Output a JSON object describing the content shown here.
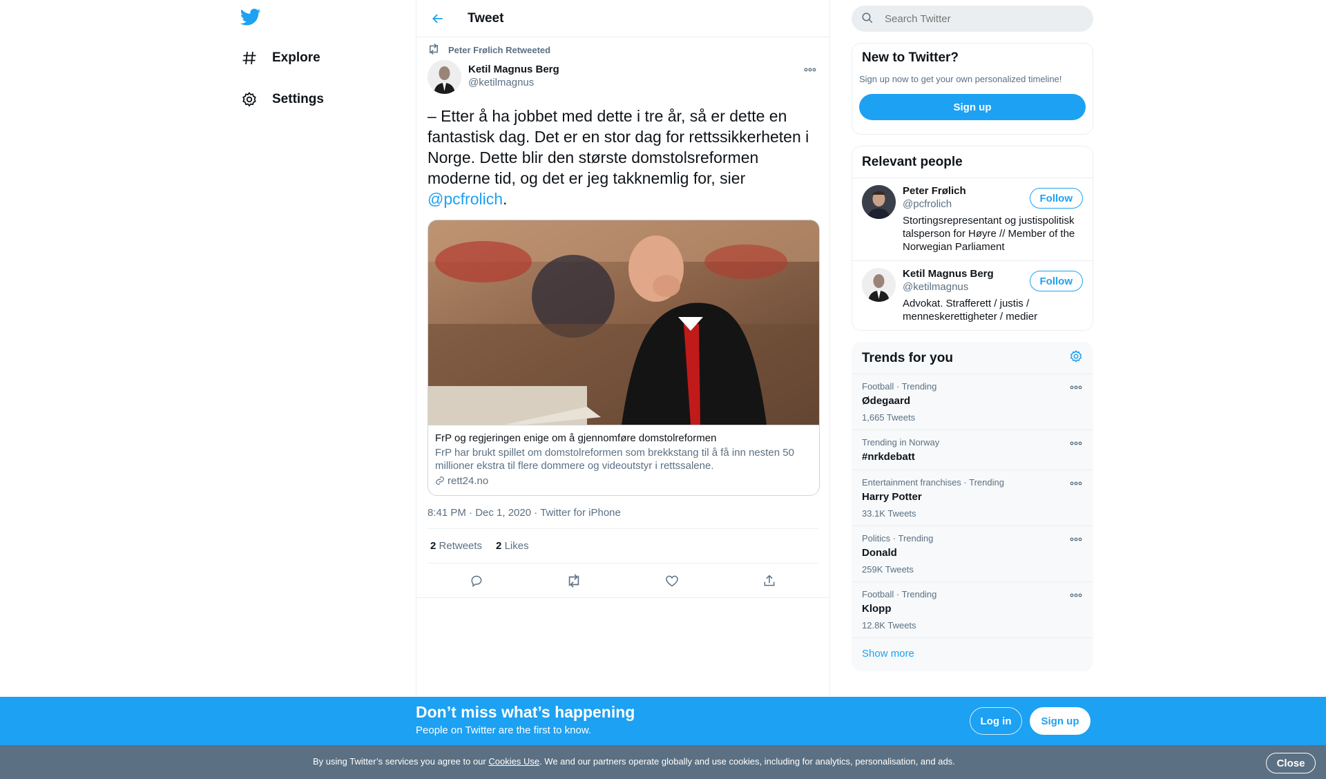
{
  "nav": {
    "items": [
      {
        "label": "Explore",
        "icon": "hashtag-icon"
      },
      {
        "label": "Settings",
        "icon": "gear-icon"
      }
    ]
  },
  "header": {
    "title": "Tweet"
  },
  "tweet": {
    "retweeted_by": "Peter Frølich Retweeted",
    "author_name": "Ketil Magnus Berg",
    "author_handle": "@ketilmagnus",
    "text_before": "– Etter å ha jobbet med dette i tre år, så er dette en fantastisk dag. Det er en stor dag for rettssikkerheten i Norge. Dette blir den største domstolsreformen moderne tid, og det er jeg takknemlig for, sier ",
    "mention": "@pcfrolich",
    "text_after": ".",
    "card": {
      "title": "FrP og regjeringen enige om å gjennomføre domstolreformen",
      "description": "FrP har brukt spillet om domstolreformen som brekkstang til å få inn nesten 50 millioner ekstra til flere dommere og videoutstyr i rettssalene.",
      "domain": "rett24.no"
    },
    "meta": "8:41 PM · Dec 1, 2020 · Twitter for iPhone",
    "retweets_count": "2",
    "retweets_label": "Retweets",
    "likes_count": "2",
    "likes_label": "Likes"
  },
  "search": {
    "placeholder": "Search Twitter"
  },
  "new_to_twitter": {
    "title": "New to Twitter?",
    "subtitle": "Sign up now to get your own personalized timeline!",
    "button": "Sign up"
  },
  "relevant": {
    "title": "Relevant people",
    "people": [
      {
        "name": "Peter Frølich",
        "handle": "@pcfrolich",
        "bio": "Stortingsrepresentant og justispolitisk talsperson for Høyre // Member of the Norwegian Parliament",
        "button": "Follow"
      },
      {
        "name": "Ketil Magnus Berg",
        "handle": "@ketilmagnus",
        "bio": "Advokat. Strafferett / justis / menneskerettigheter / medier",
        "button": "Follow"
      }
    ]
  },
  "trends": {
    "title": "Trends for you",
    "items": [
      {
        "category": "Football · Trending",
        "name": "Ødegaard",
        "count": "1,665 Tweets"
      },
      {
        "category": "Trending in Norway",
        "name": "#nrkdebatt",
        "count": ""
      },
      {
        "category": "Entertainment franchises · Trending",
        "name": "Harry Potter",
        "count": "33.1K Tweets"
      },
      {
        "category": "Politics · Trending",
        "name": "Donald",
        "count": "259K Tweets"
      },
      {
        "category": "Football · Trending",
        "name": "Klopp",
        "count": "12.8K Tweets"
      }
    ],
    "show_more": "Show more"
  },
  "banner": {
    "title": "Don’t miss what’s happening",
    "subtitle": "People on Twitter are the first to know.",
    "login": "Log in",
    "signup": "Sign up"
  },
  "cookie": {
    "text_before": "By using Twitter’s services you agree to our ",
    "link": "Cookies Use",
    "text_after": ". We and our partners operate globally and use cookies, including for analytics, personalisation, and ads.",
    "close": "Close"
  },
  "colors": {
    "accent": "#1da1f2",
    "secondary_text": "#5b7083",
    "border": "#ebeef0"
  }
}
